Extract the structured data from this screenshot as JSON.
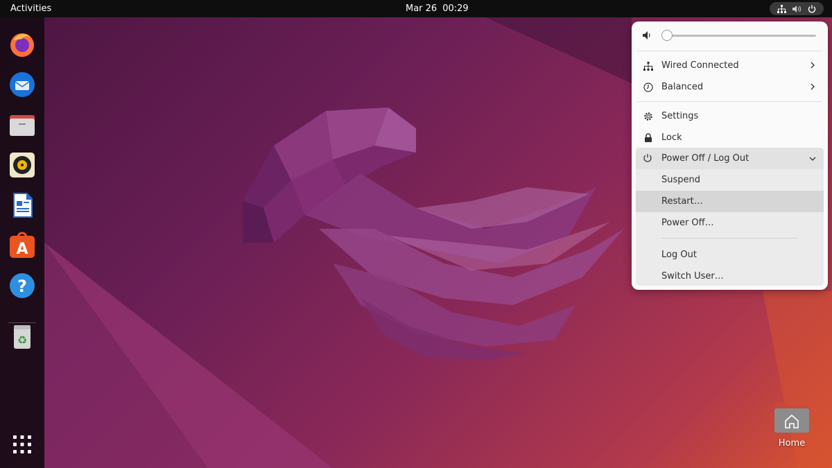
{
  "topbar": {
    "activities": "Activities",
    "date": "Mar 26",
    "time": "00:29",
    "tray_icons": [
      "network-icon",
      "volume-icon",
      "power-icon"
    ]
  },
  "dock": {
    "apps": [
      "firefox-icon",
      "thunderbird-icon",
      "files-icon",
      "rhythmbox-icon",
      "libreoffice-writer-icon",
      "software-center-icon",
      "help-icon",
      "trash-icon"
    ],
    "show_apps_icon": "app-grid-icon"
  },
  "menu": {
    "volume_level": 0.0,
    "network_label": "Wired Connected",
    "power_mode_label": "Balanced",
    "settings_label": "Settings",
    "lock_label": "Lock",
    "power_menu_label": "Power Off / Log Out",
    "power_items": {
      "suspend": "Suspend",
      "restart": "Restart…",
      "power_off": "Power Off…",
      "log_out": "Log Out",
      "switch_user": "Switch User…"
    }
  },
  "desktop": {
    "home_label": "Home"
  },
  "colors": {
    "topbar": "#0e0e0e",
    "menu_bg": "#fafafa",
    "submenu_bg": "#ebebeb",
    "accent_orange": "#e95420",
    "wallpaper_purple": "#6a1f55"
  }
}
